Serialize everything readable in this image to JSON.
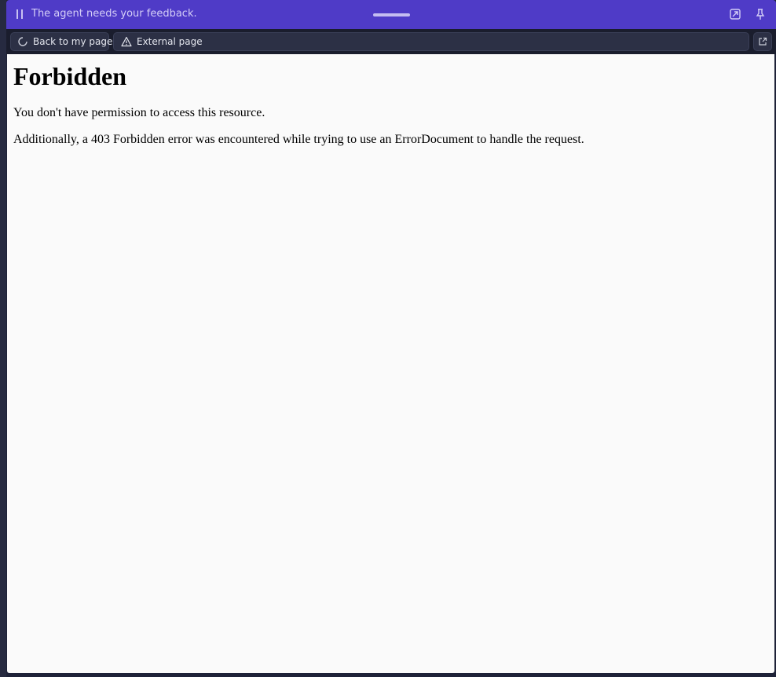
{
  "topbar": {
    "status_text": "The agent needs your feedback.",
    "icons": [
      "pause-icon",
      "drag-handle",
      "expand-icon",
      "pin-icon"
    ],
    "accent_color": "#4f3bc7"
  },
  "toolbar": {
    "back_label": "Back to my page",
    "back_icon": "spinner-icon",
    "url_label": "External page",
    "url_icon": "warning-icon",
    "open_icon": "external-link-icon"
  },
  "page": {
    "heading": "Forbidden",
    "paragraph_1": "You don't have permission to access this resource.",
    "paragraph_2": "Additionally, a 403 Forbidden error was encountered while trying to use an ErrorDocument to handle the request."
  }
}
